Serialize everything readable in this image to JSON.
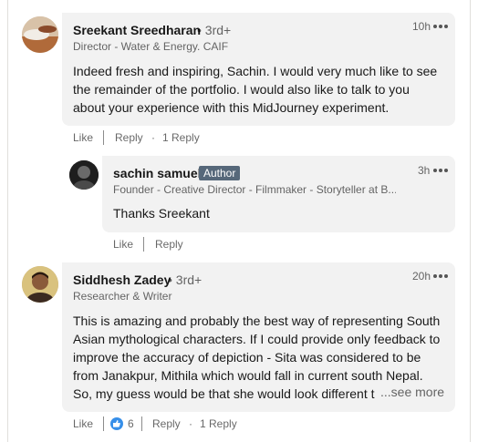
{
  "comments": [
    {
      "author": "Sreekant Sreedharan",
      "degree": "• 3rd+",
      "headline": "Director - Water & Energy. CAIF",
      "time": "10h",
      "text_lines": [
        "Indeed fresh and inspiring, Sachin. I would very much like to see",
        "the remainder of the portfolio. I would also like to talk to you",
        "about your experience with this MidJourney experiment."
      ],
      "actions": {
        "like": "Like",
        "reply": "Reply",
        "replies": "1 Reply"
      }
    },
    {
      "author": "sachin samuel",
      "badge": "Author",
      "headline": "Founder - Creative Director - Filmmaker - Storyteller at B...",
      "time": "3h",
      "text_lines": [
        "Thanks Sreekant"
      ],
      "actions": {
        "like": "Like",
        "reply": "Reply"
      }
    },
    {
      "author": "Siddhesh Zadey",
      "degree": "• 3rd+",
      "headline": "Researcher & Writer",
      "time": "20h",
      "text_lines": [
        "This is amazing and probably the best way of representing South",
        "Asian mythological characters. If I could provide only feedback to",
        "improve the accuracy of depiction - Sita was considered to be",
        "from Janakpur, Mithila which would fall in current south Nepal.",
        "So, my guess would be that she would look different t"
      ],
      "see_more": "...see more",
      "reactions_count": "6",
      "actions": {
        "like": "Like",
        "reply": "Reply",
        "replies": "1 Reply"
      }
    }
  ],
  "separator_dot": "·",
  "colors": {
    "badge": "#56687a",
    "like_reaction": "#378fe9",
    "bubble": "#f2f2f2"
  }
}
